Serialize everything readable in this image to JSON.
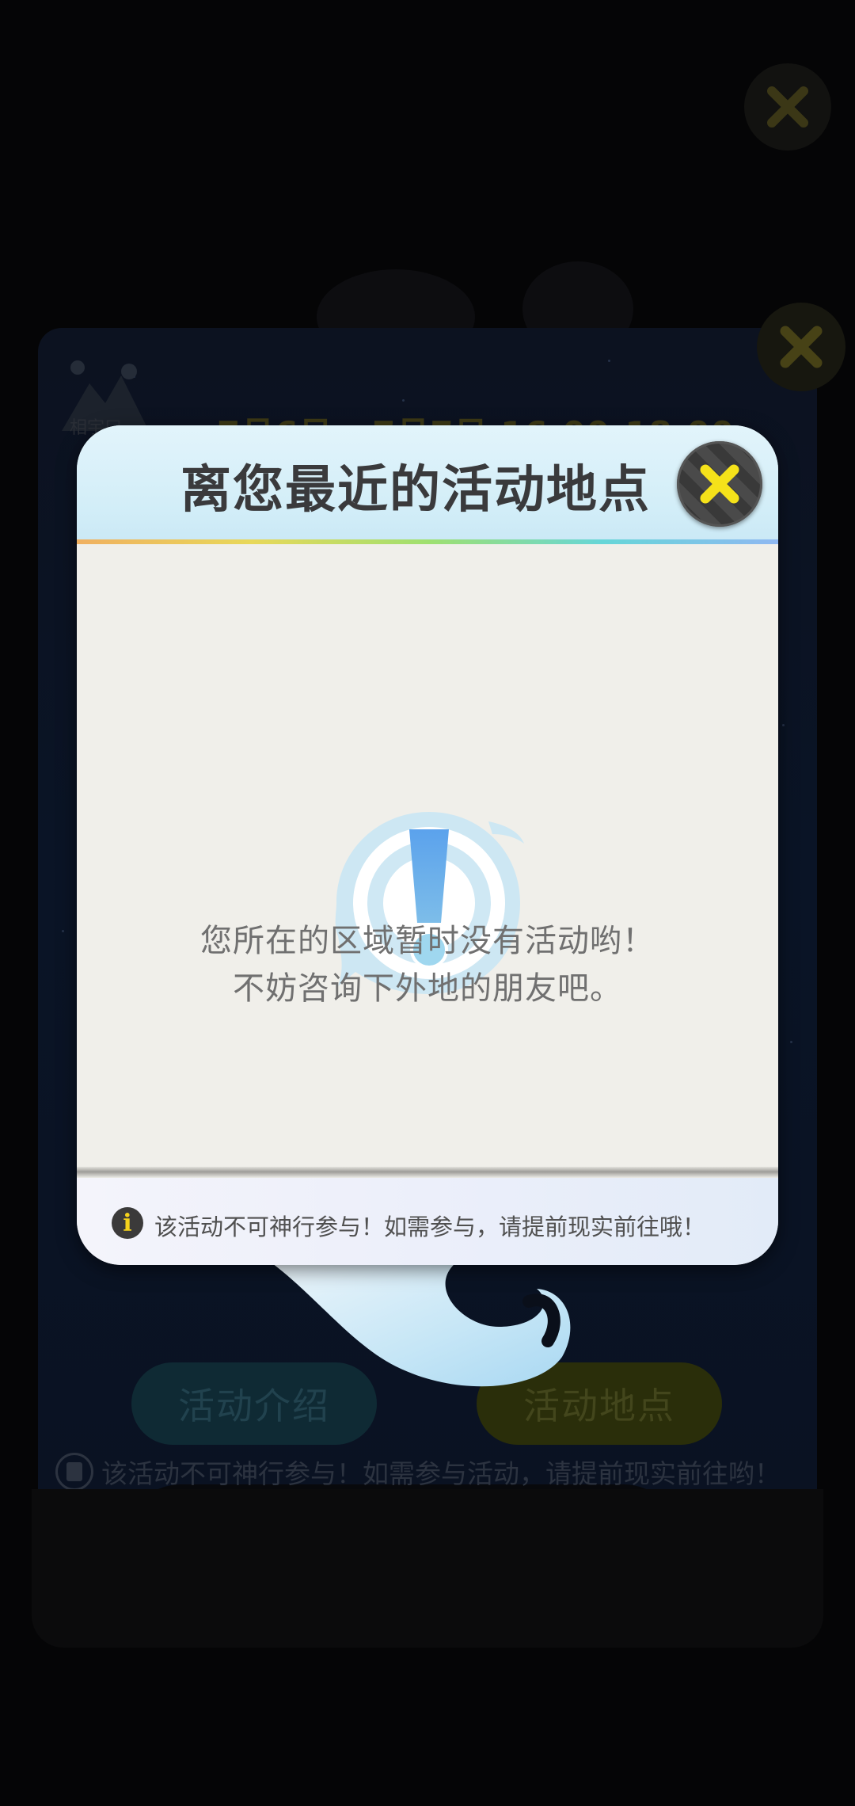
{
  "background": {
    "event_date": "7月6日 - 7月7日 16:00-18:00",
    "logo_text": "相宇口",
    "buttons": {
      "intro": "活动介绍",
      "location": "活动地点"
    },
    "notice": "该活动不可神行参与！如需参与活动，请提前现实前往哟！",
    "close_icon": "close-icon"
  },
  "dialog": {
    "title": "离您最近的活动地点",
    "message_line1": "您所在的区域暂时没有活动哟！",
    "message_line2": "不妨咨询下外地的朋友吧。",
    "footer_notice": "该活动不可神行参与！如需参与，请提前现实前往哦！",
    "info_icon_glyph": "i",
    "close_icon": "close-icon",
    "alert_icon": "exclamation-icon"
  },
  "colors": {
    "accent_yellow": "#f5e21a",
    "header_blue": "#d3eef8",
    "body_bg": "#f0efea",
    "alert_blue": "#5aa8ea"
  }
}
